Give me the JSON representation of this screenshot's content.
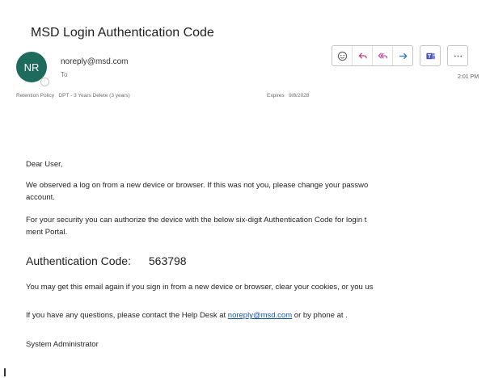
{
  "email": {
    "subject": "MSD  Login Authentication Code",
    "avatar_initials": "NR",
    "sender": "noreply@msd.com",
    "to_label": "To",
    "retention_label": "Retention Policy",
    "retention_value": "DPT - 3 Years Delete (3 years)",
    "expires_label": "Expires",
    "expires_value": "9/8/2028",
    "time": "2:01 PM"
  },
  "body": {
    "greeting": "Dear User,",
    "p1_line1": "We observed a log on from a new device or browser. If this was not you, please change your passwo",
    "p1_line2": "account.",
    "p2_line1": "For your security you can authorize the device with the below six-digit Authentication Code for login t",
    "p2_line2": "ment Portal.",
    "auth_label": "Authentication Code:",
    "auth_code": "563798",
    "p3": "You may get this email again if you sign in from a new device or browser, clear your cookies, or you us",
    "p4_before": "If you have any questions, please contact the Help Desk at ",
    "p4_link": "noreply@msd.com",
    "p4_after": " or by phone at .",
    "signature": "System Administrator"
  },
  "toolbar": {
    "icons": [
      "emoji-icon",
      "reply-icon",
      "reply-all-icon",
      "forward-icon",
      "teams-icon",
      "more-icon"
    ]
  },
  "colors": {
    "avatar": "#1d6b5c",
    "reply_icons": "#c43d8a",
    "forward_icon": "#2b7cd3",
    "teams_icon": "#4b53bc",
    "link": "#1155cc"
  }
}
